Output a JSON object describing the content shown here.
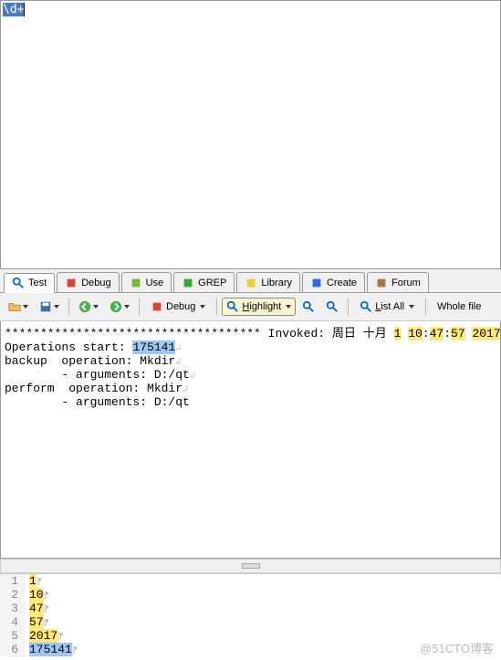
{
  "regex_input": "\\d+",
  "tabs": {
    "test": "Test",
    "debug": "Debug",
    "use": "Use",
    "grep": "GREP",
    "library": "Library",
    "create": "Create",
    "forum": "Forum"
  },
  "toolbar": {
    "debug_label": "Debug",
    "highlight_label": "Highlight",
    "list_all_label": "List All",
    "whole_file_label": "Whole file"
  },
  "result": {
    "stars": "************************************",
    "invoked_label": "Invoked:",
    "invoked_day": "周日",
    "invoked_month": "十月",
    "d": "1",
    "h": "10",
    "m": "47",
    "s": "57",
    "y": "2017",
    "line2a": "Operations start:",
    "line2b": "175141",
    "line3": "backup  operation: Mkdir",
    "line4": "        - arguments: D:/qt",
    "line5": "perform  operation: Mkdir",
    "line6": "        - arguments: D:/qt"
  },
  "matches": [
    {
      "n": "1",
      "v": "1"
    },
    {
      "n": "2",
      "v": "10"
    },
    {
      "n": "3",
      "v": "47"
    },
    {
      "n": "4",
      "v": "57"
    },
    {
      "n": "5",
      "v": "2017"
    },
    {
      "n": "6",
      "v": "175141"
    }
  ],
  "watermark": "@51CTO博客"
}
